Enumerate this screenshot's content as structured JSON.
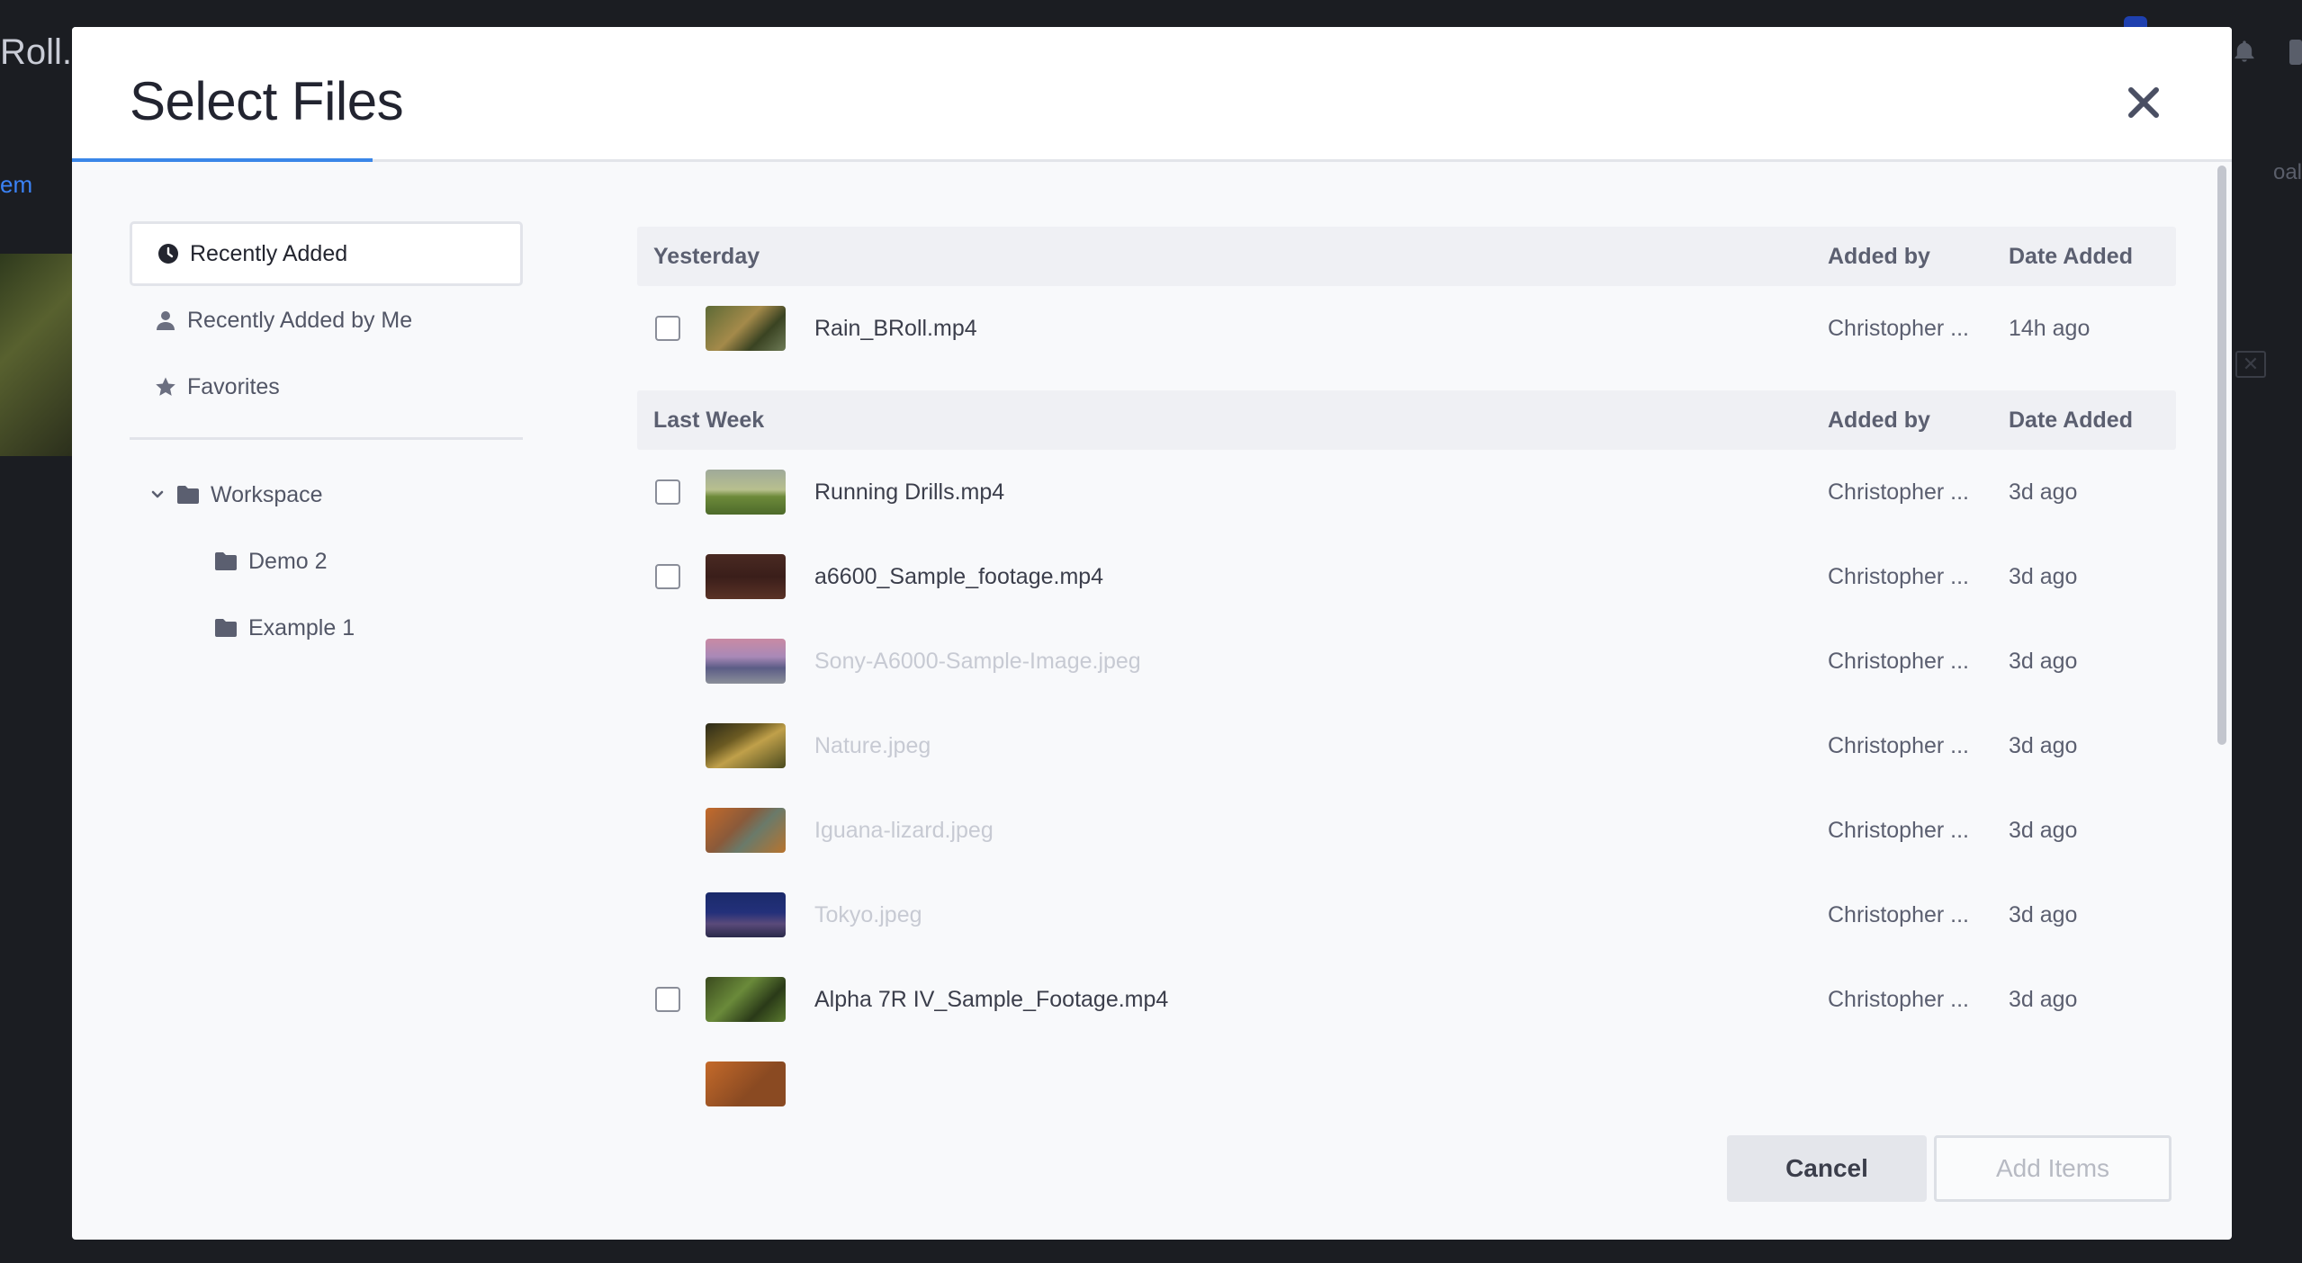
{
  "background": {
    "app_title": "Roll.",
    "link_text": "em",
    "right_text": "oal"
  },
  "modal": {
    "title": "Select Files",
    "accent_color": "#3a86e8"
  },
  "sidebar": {
    "nav": [
      {
        "label": "Recently Added",
        "icon": "clock-icon",
        "active": true
      },
      {
        "label": "Recently Added by Me",
        "icon": "user-icon",
        "active": false
      },
      {
        "label": "Favorites",
        "icon": "star-icon",
        "active": false
      }
    ],
    "tree": {
      "root": {
        "label": "Workspace",
        "expanded": true
      },
      "children": [
        {
          "label": "Demo 2"
        },
        {
          "label": "Example 1"
        }
      ]
    }
  },
  "groups": [
    {
      "title": "Yesterday",
      "added_by_header": "Added by",
      "date_header": "Date Added",
      "files": [
        {
          "name": "Rain_BRoll.mp4",
          "added_by": "Christopher ...",
          "date": "14h ago",
          "selectable": true
        }
      ]
    },
    {
      "title": "Last Week",
      "added_by_header": "Added by",
      "date_header": "Date Added",
      "files": [
        {
          "name": "Running Drills.mp4",
          "added_by": "Christopher ...",
          "date": "3d ago",
          "selectable": true
        },
        {
          "name": "a6600_Sample_footage.mp4",
          "added_by": "Christopher ...",
          "date": "3d ago",
          "selectable": true
        },
        {
          "name": "Sony-A6000-Sample-Image.jpeg",
          "added_by": "Christopher ...",
          "date": "3d ago",
          "selectable": false
        },
        {
          "name": "Nature.jpeg",
          "added_by": "Christopher ...",
          "date": "3d ago",
          "selectable": false
        },
        {
          "name": "Iguana-lizard.jpeg",
          "added_by": "Christopher ...",
          "date": "3d ago",
          "selectable": false
        },
        {
          "name": "Tokyo.jpeg",
          "added_by": "Christopher ...",
          "date": "3d ago",
          "selectable": false
        },
        {
          "name": "Alpha 7R IV_Sample_Footage.mp4",
          "added_by": "Christopher ...",
          "date": "3d ago",
          "selectable": true
        },
        {
          "name": "",
          "added_by": "",
          "date": "",
          "selectable": false
        }
      ]
    }
  ],
  "footer": {
    "cancel_label": "Cancel",
    "add_label": "Add Items"
  }
}
